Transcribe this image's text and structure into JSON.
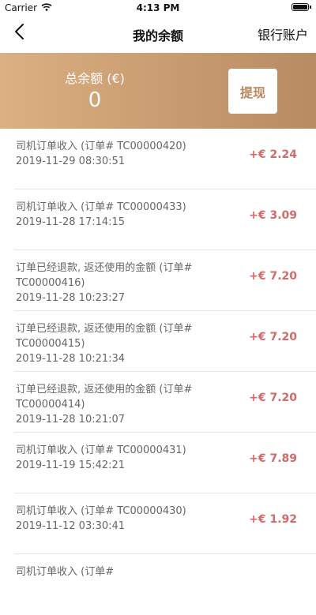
{
  "status_bar": {
    "carrier": "Carrier",
    "time": "4:13 PM"
  },
  "nav": {
    "title": "我的余额",
    "right_action": "银行账户"
  },
  "balance": {
    "label": "总余额 (€)",
    "value": "0",
    "withdraw_label": "提现"
  },
  "transactions": [
    {
      "title": "司机订单收入 (订单# TC00000420)",
      "date": "2019-11-29 08:30:51",
      "amount": "+€ 2.24"
    },
    {
      "title": "司机订单收入 (订单# TC00000433)",
      "date": "2019-11-28 17:14:15",
      "amount": "+€ 3.09"
    },
    {
      "title": "订单已经退款, 返还使用的金额 (订单# TC00000416)",
      "date": "2019-11-28 10:23:27",
      "amount": "+€ 7.20"
    },
    {
      "title": "订单已经退款, 返还使用的金额 (订单# TC00000415)",
      "date": "2019-11-28 10:21:34",
      "amount": "+€ 7.20"
    },
    {
      "title": "订单已经退款, 返还使用的金额 (订单# TC00000414)",
      "date": "2019-11-28 10:21:07",
      "amount": "+€ 7.20"
    },
    {
      "title": "司机订单收入 (订单# TC00000431)",
      "date": "2019-11-19 15:42:21",
      "amount": "+€ 7.89"
    },
    {
      "title": "司机订单收入 (订单# TC00000430)",
      "date": "2019-11-12 03:30:41",
      "amount": "+€ 1.92"
    },
    {
      "title": "司机订单收入 (订单#",
      "date": "",
      "amount": ""
    }
  ],
  "colors": {
    "banner_start": "#dcb082",
    "banner_end": "#b88c62",
    "amount_positive": "#d36a6a",
    "withdraw_text": "#b98a60"
  },
  "icons": {
    "back": "chevron-left-icon",
    "wifi": "wifi-icon",
    "battery": "battery-icon"
  }
}
